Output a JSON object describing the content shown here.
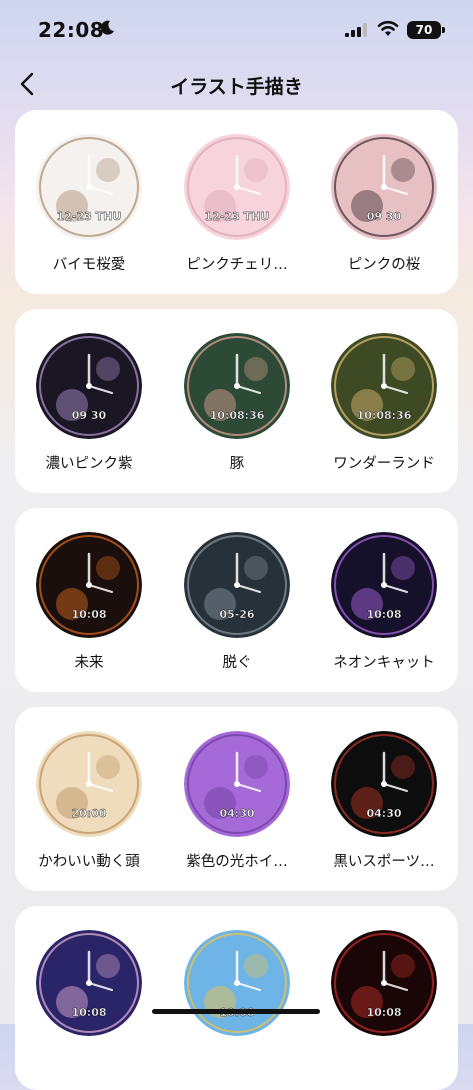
{
  "status": {
    "time": "22:08",
    "battery": "70"
  },
  "header": {
    "title": "イラスト手描き"
  },
  "cards": [
    {
      "items": [
        {
          "name": "バイモ桜愛",
          "colors": [
            "#f4f1ef",
            "#a68a6c"
          ],
          "face_text": "12-23 THU"
        },
        {
          "name": "ピンクチェリ…",
          "colors": [
            "#f7d4dc",
            "#d8a4b0"
          ],
          "face_text": "12-23 THU"
        },
        {
          "name": "ピンクの桜",
          "colors": [
            "#e7c0c4",
            "#3a2a30"
          ],
          "face_text": "09 30"
        }
      ]
    },
    {
      "items": [
        {
          "name": "濃いピンク紫",
          "colors": [
            "#1b1624",
            "#b49ad6"
          ],
          "face_text": "09 30"
        },
        {
          "name": "豚",
          "colors": [
            "#2c4a35",
            "#e9a79a"
          ],
          "face_text": "10:08:36"
        },
        {
          "name": "ワンダーランド",
          "colors": [
            "#3d4a24",
            "#e9c27a"
          ],
          "face_text": "10:08:36"
        }
      ]
    },
    {
      "items": [
        {
          "name": "未来",
          "colors": [
            "#1a0f0c",
            "#e06a20"
          ],
          "face_text": "10:08"
        },
        {
          "name": "脱ぐ",
          "colors": [
            "#27313a",
            "#8b9aa4"
          ],
          "face_text": "05-26"
        },
        {
          "name": "ネオンキャット",
          "colors": [
            "#15112a",
            "#b46be8"
          ],
          "face_text": "10:08"
        }
      ]
    },
    {
      "items": [
        {
          "name": "かわいい動く頭",
          "colors": [
            "#efdcbc",
            "#b88b5a"
          ],
          "face_text": "20:00"
        },
        {
          "name": "紫色の光ホイ…",
          "colors": [
            "#a56ad7",
            "#6b3a9c"
          ],
          "face_text": "04:30"
        },
        {
          "name": "黒いスポーツ…",
          "colors": [
            "#0d0d0d",
            "#c0392b"
          ],
          "face_text": "04:30"
        }
      ]
    },
    {
      "items": [
        {
          "name": "",
          "colors": [
            "#2a2468",
            "#e9b8d8"
          ],
          "face_text": "10:08"
        },
        {
          "name": "",
          "colors": [
            "#6fb4e6",
            "#f3c33e"
          ],
          "face_text": "10:08"
        },
        {
          "name": "",
          "colors": [
            "#1a0606",
            "#c9302c"
          ],
          "face_text": "10:08"
        }
      ]
    }
  ]
}
